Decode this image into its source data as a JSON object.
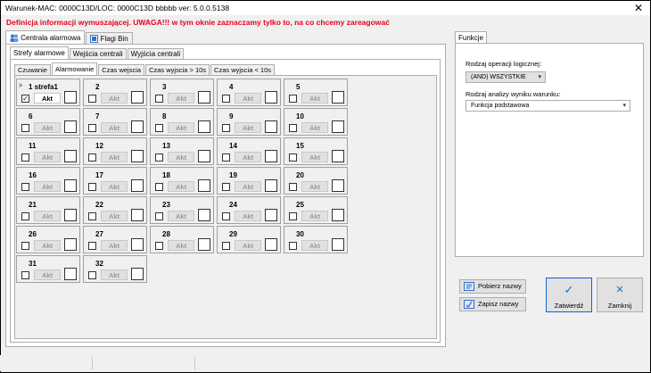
{
  "window": {
    "title": "Warunek-MAC: 0000C13D/LOC: 0000C13D bbbbb ver: 5.0.0.5138",
    "close_label": "✕"
  },
  "warning": "Definicja informacji wymuszającej. UWAGA!!! w tym oknie zaznaczamy tylko to, na co chcemy zareagować",
  "top_tabs": [
    "Centrala alarmowa",
    "Flagi Bin"
  ],
  "zone_tabs": [
    "Strefy alarmowe",
    "Wejścia centrali",
    "Wyjścia centrali"
  ],
  "sub_tabs": [
    "Czuwanie",
    "Alarmowanie",
    "Czas wejscia",
    "Czas wyjscia > 10s",
    "Czas wyjscia < 10s"
  ],
  "cells": [
    {
      "label": "1 strefa1",
      "marker": ">",
      "checked": true,
      "akt": "Akt",
      "akt_on": true
    },
    {
      "label": "2",
      "akt": "Akt"
    },
    {
      "label": "3",
      "akt": "Akt"
    },
    {
      "label": "4",
      "akt": "Akt"
    },
    {
      "label": "5",
      "akt": "Akt"
    },
    {
      "label": "6",
      "akt": "Akt"
    },
    {
      "label": "7",
      "akt": "Akt"
    },
    {
      "label": "8",
      "akt": "Akt"
    },
    {
      "label": "9",
      "akt": "Akt"
    },
    {
      "label": "10",
      "akt": "Akt"
    },
    {
      "label": "11",
      "akt": "Akt"
    },
    {
      "label": "12",
      "akt": "Akt"
    },
    {
      "label": "13",
      "akt": "Akt"
    },
    {
      "label": "14",
      "akt": "Akt"
    },
    {
      "label": "15",
      "akt": "Akt"
    },
    {
      "label": "16",
      "akt": "Akt"
    },
    {
      "label": "17",
      "akt": "Akt"
    },
    {
      "label": "18",
      "akt": "Akt"
    },
    {
      "label": "19",
      "akt": "Akt"
    },
    {
      "label": "20",
      "akt": "Akt"
    },
    {
      "label": "21",
      "akt": "Akt"
    },
    {
      "label": "22",
      "akt": "Akt"
    },
    {
      "label": "23",
      "akt": "Akt"
    },
    {
      "label": "24",
      "akt": "Akt"
    },
    {
      "label": "25",
      "akt": "Akt"
    },
    {
      "label": "26",
      "akt": "Akt"
    },
    {
      "label": "27",
      "akt": "Akt"
    },
    {
      "label": "28",
      "akt": "Akt"
    },
    {
      "label": "29",
      "akt": "Akt"
    },
    {
      "label": "30",
      "akt": "Akt"
    },
    {
      "label": "31",
      "akt": "Akt"
    },
    {
      "label": "32",
      "akt": "Akt"
    }
  ],
  "right": {
    "tab": "Funkcje",
    "logic_label": "Rodzaj operacji logicznej:",
    "logic_value": "(AND) WSZYSTKIE",
    "analysis_label": "Rodzaj analizy wyniku warunku:",
    "analysis_value": "Funkcja podstawowa"
  },
  "buttons": {
    "fetch": "Pobierz nazwy",
    "save": "Zapisz nazwy",
    "confirm": "Zatwierdź",
    "close": "Zamknij"
  },
  "icons": {
    "confirm": "✓",
    "close": "✕",
    "arrow": "▾"
  }
}
